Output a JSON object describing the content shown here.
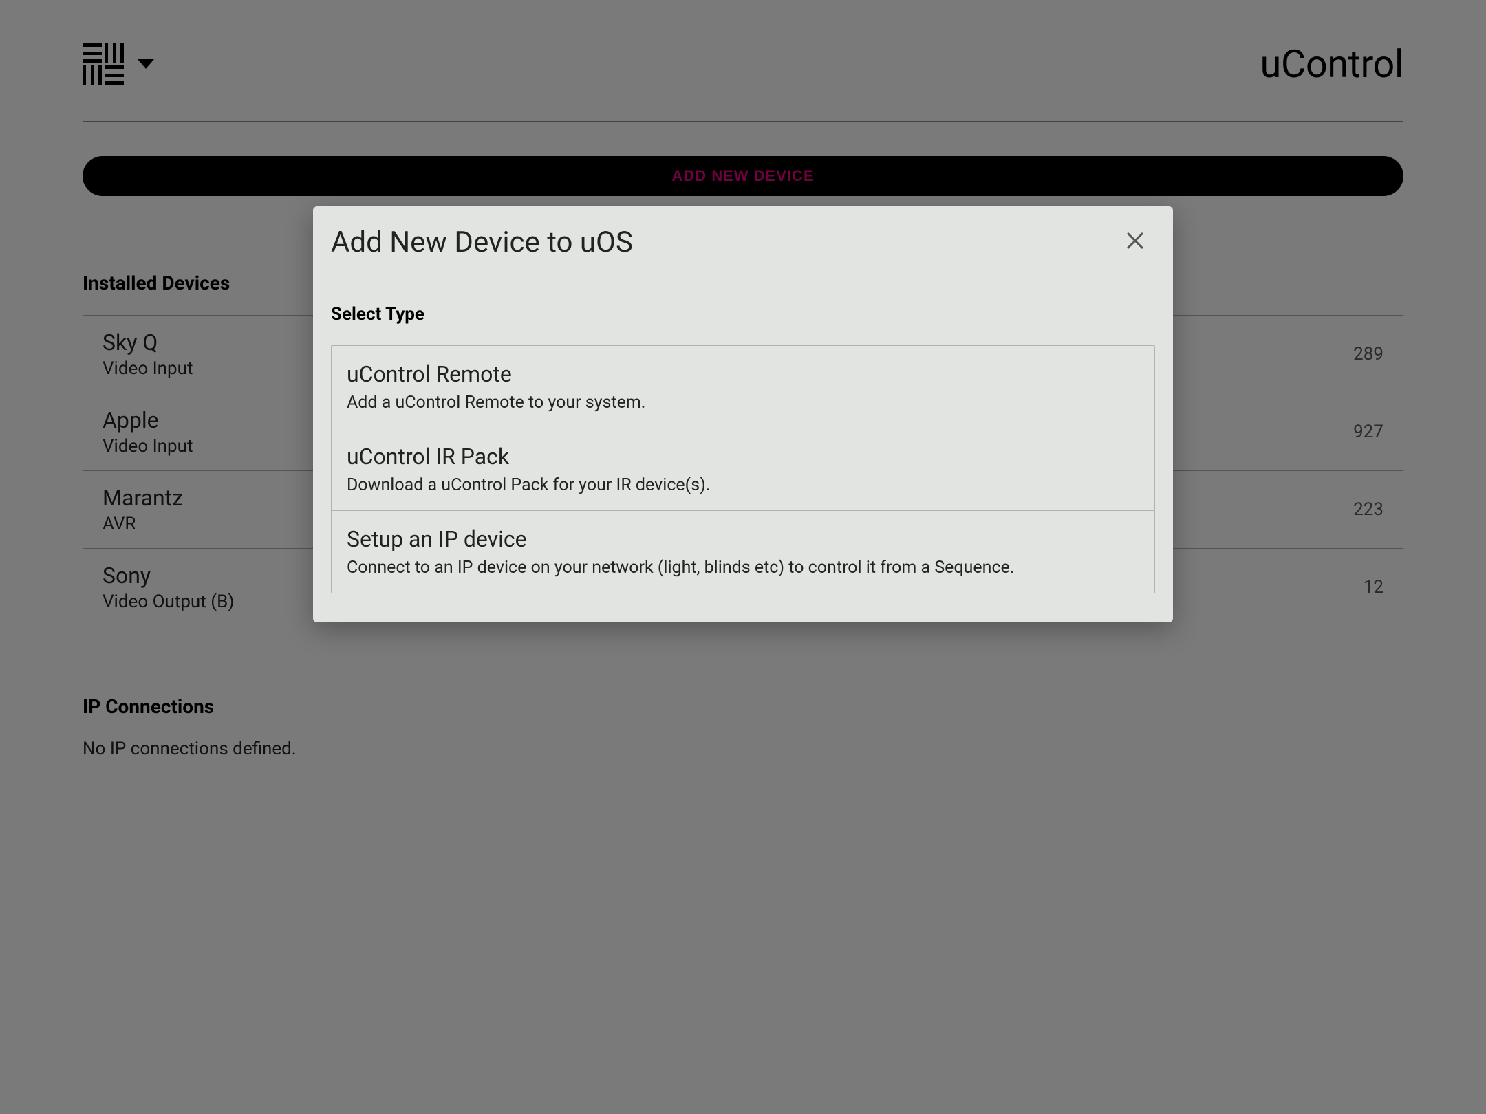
{
  "header": {
    "brand": "uControl"
  },
  "toolbar": {
    "add_button_label": "ADD NEW DEVICE"
  },
  "sections": {
    "installed_devices_title": "Installed Devices",
    "ip_connections_title": "IP Connections",
    "ip_empty_text": "No IP connections defined."
  },
  "devices": [
    {
      "name": "Sky Q",
      "type": "Video Input",
      "count": "289"
    },
    {
      "name": "Apple",
      "type": "Video Input",
      "count": "927"
    },
    {
      "name": "Marantz",
      "type": "AVR",
      "count": "223"
    },
    {
      "name": "Sony",
      "type": "Video Output (B)",
      "count": "12"
    }
  ],
  "modal": {
    "title": "Add New Device to uOS",
    "select_label": "Select Type",
    "options": [
      {
        "title": "uControl Remote",
        "desc": "Add a uControl Remote to your system."
      },
      {
        "title": "uControl IR Pack",
        "desc": "Download a uControl Pack for your IR device(s)."
      },
      {
        "title": "Setup an IP device",
        "desc": "Connect to an IP device on your network (light, blinds etc) to control it from a Sequence."
      }
    ]
  }
}
